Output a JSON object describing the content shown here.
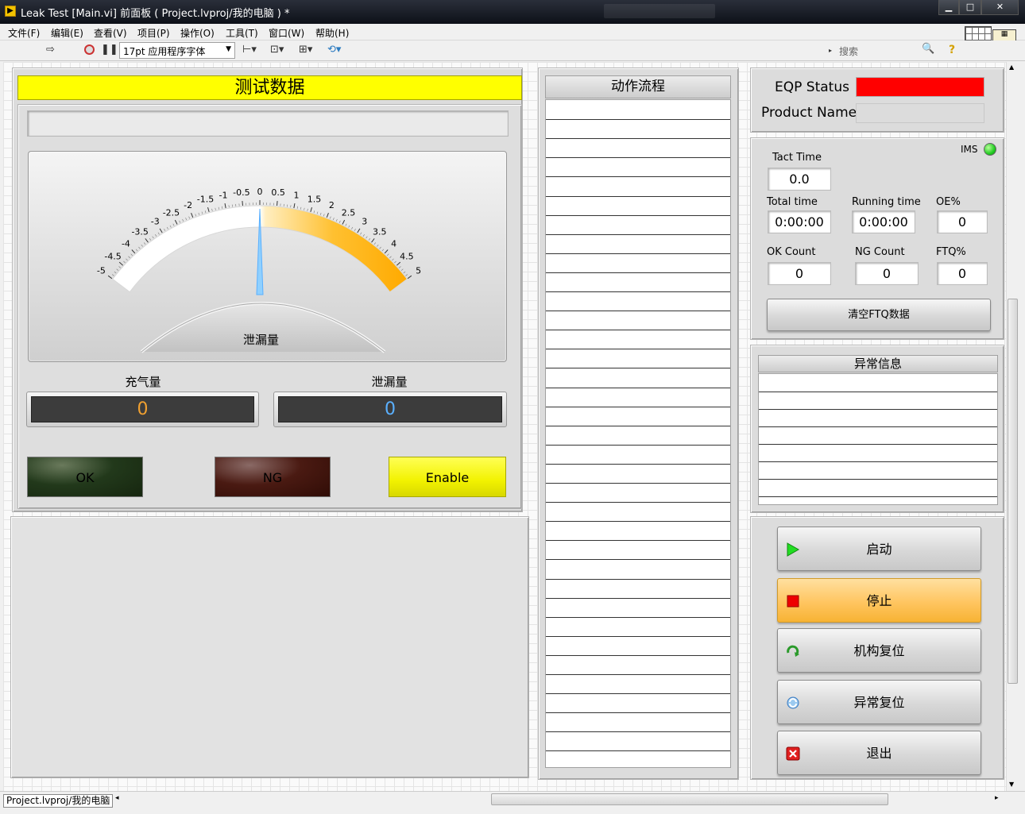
{
  "window": {
    "title": "Leak Test [Main.vi] 前面板 ( Project.lvproj/我的电脑 ) *"
  },
  "menu": [
    "文件(F)",
    "编辑(E)",
    "查看(V)",
    "项目(P)",
    "操作(O)",
    "工具(T)",
    "窗口(W)",
    "帮助(H)"
  ],
  "toolbar": {
    "font": "17pt 应用程序字体",
    "search_placeholder": "搜索"
  },
  "test": {
    "title": "测试数据",
    "gauge": {
      "label": "泄漏量",
      "min": -5,
      "max": 5,
      "value": 0,
      "ticks": [
        "-5",
        "-4.5",
        "-4",
        "-3.5",
        "-3",
        "-2.5",
        "-2",
        "-1.5",
        "-1",
        "-0.5",
        "0",
        "0.5",
        "1",
        "1.5",
        "2",
        "2.5",
        "3",
        "3.5",
        "4",
        "4.5",
        "5"
      ]
    },
    "charge": {
      "label": "充气量",
      "value": "0"
    },
    "leak": {
      "label": "泄漏量",
      "value": "0"
    },
    "ok_label": "OK",
    "ng_label": "NG",
    "enable_label": "Enable"
  },
  "flow": {
    "title": "动作流程"
  },
  "status": {
    "eqp_label": "EQP Status",
    "eqp_color": "#ff0000",
    "product_label": "Product Name",
    "product_value": ""
  },
  "stats": {
    "ims_label": "IMS",
    "tact_label": "Tact Time",
    "tact_value": "0.0",
    "total_label": "Total time",
    "total_value": "0:00:00",
    "running_label": "Running time",
    "running_value": "0:00:00",
    "oe_label": "OE%",
    "oe_value": "0",
    "ok_label": "OK Count",
    "ok_value": "0",
    "ng_label": "NG Count",
    "ng_value": "0",
    "ftq_label": "FTQ%",
    "ftq_value": "0",
    "clear_label": "清空FTQ数据"
  },
  "alarm": {
    "title": "异常信息"
  },
  "actions": {
    "start": "启动",
    "stop": "停止",
    "home": "机构复位",
    "reset": "异常复位",
    "exit": "退出"
  },
  "statusbar": {
    "path": "Project.lvproj/我的电脑"
  }
}
